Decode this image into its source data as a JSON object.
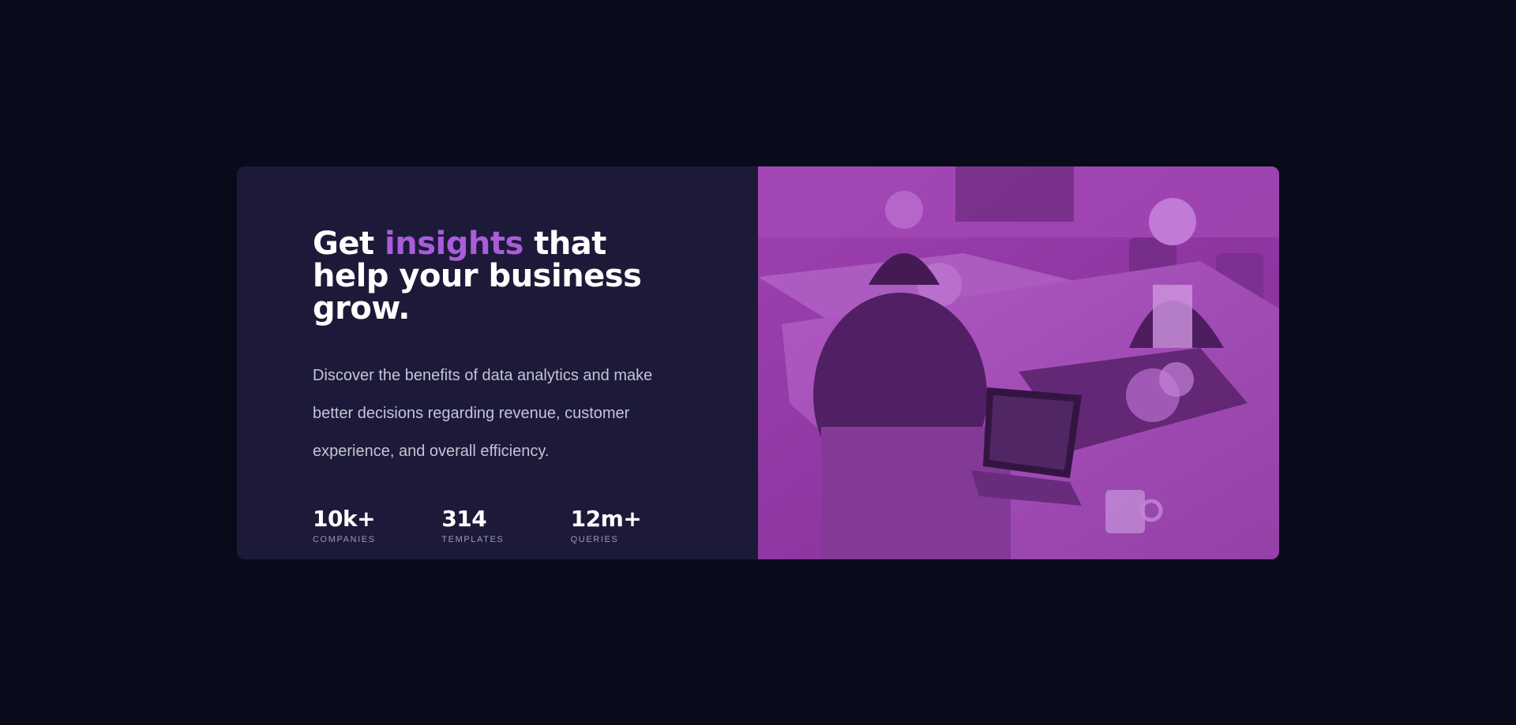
{
  "headline": {
    "before": "Get ",
    "accent": "insights",
    "after": " that help your business grow."
  },
  "description": "Discover the benefits of data analytics and make better decisions regarding revenue, customer experience, and overall efficiency.",
  "stats": [
    {
      "value": "10k+",
      "label": "COMPANIES"
    },
    {
      "value": "314",
      "label": "TEMPLATES"
    },
    {
      "value": "12m+",
      "label": "QUERIES"
    }
  ],
  "image": {
    "description_icon": "office-team-photo",
    "overlay_color": "#aa5cdb"
  },
  "colors": {
    "page_background": "#090b1a",
    "card_background": "#1c1a38",
    "accent": "#aa5cdb"
  }
}
